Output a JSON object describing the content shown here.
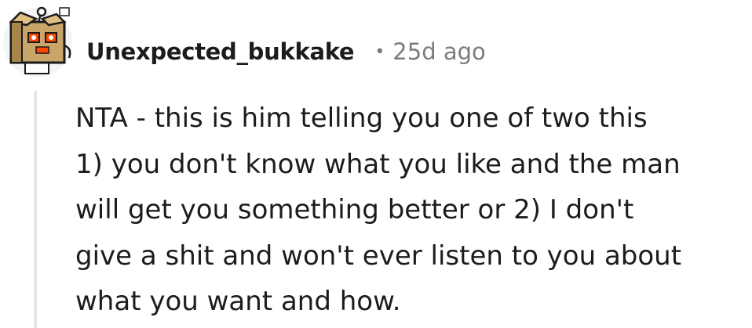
{
  "comment": {
    "author": "Unexpected_bukkake",
    "separator": "•",
    "age": "25d ago",
    "body_lines": [
      "NTA - this is him telling you one of two this",
      "1) you don't know what you like and the man",
      "will get you something better or 2) I don't",
      "give a shit and won't ever listen to you about",
      "what you want and how."
    ]
  },
  "avatar": {
    "icon": "reddit-snoo-box-costume-avatar",
    "colors": {
      "box": "#c9a56a",
      "eye": "#ff4500",
      "circle_bg": "#f2f4f5"
    }
  }
}
